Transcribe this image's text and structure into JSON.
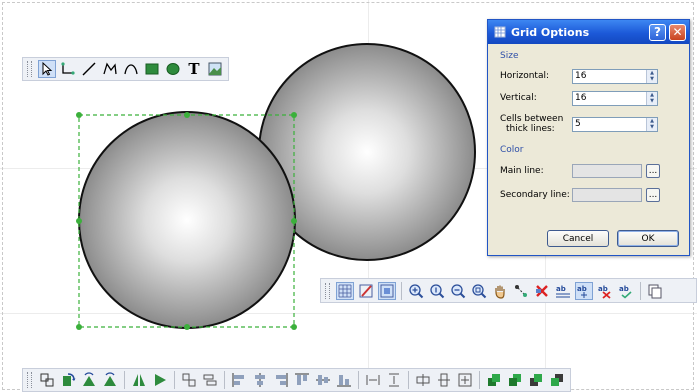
{
  "dialog": {
    "title": "Grid Options",
    "help_label": "?",
    "close_label": "✕",
    "size_section": "Size",
    "horizontal_label": "Horizontal:",
    "horizontal_value": "16",
    "vertical_label": "Vertical:",
    "vertical_value": "16",
    "cells_label_line1": "Cells between",
    "cells_label_line2": "thick lines:",
    "cells_value": "5",
    "color_section": "Color",
    "main_line_label": "Main line:",
    "secondary_line_label": "Secondary line:",
    "ellipsis_label": "...",
    "cancel_label": "Cancel",
    "ok_label": "OK"
  },
  "colors": {
    "selection": "#3bb03b",
    "sphere_outline": "#111111",
    "title_bar": "#1c59d8",
    "section_text": "#2e4fa8"
  },
  "draw_toolbar": {
    "tools": [
      "select-icon",
      "connector-icon",
      "line-icon",
      "polyline-icon",
      "curve-icon",
      "rectangle-icon",
      "ellipse-icon",
      "text-icon",
      "image-icon"
    ],
    "text_tool_glyph": "T"
  },
  "view_toolbar": {
    "tools": [
      "grid-icon",
      "edit-grid-icon",
      "snap-grid-icon",
      "zoom-in-icon",
      "zoom-actual-icon",
      "zoom-out-icon",
      "zoom-fit-icon",
      "pan-hand-icon",
      "connect-icon",
      "delete-connection-icon",
      "align-text-icon",
      "align-text-active-icon",
      "align-text-remove-icon",
      "spell-check-icon",
      "copy-icon"
    ]
  },
  "arrange_toolbar": {
    "tools": [
      "group-icon",
      "rotate-right-icon",
      "rotate-left-icon",
      "flip-horizontal-icon",
      "flip-vertical-icon",
      "same-size-icon",
      "same-width-icon",
      "align-left-icon",
      "align-center-icon",
      "align-right-icon",
      "align-top-icon",
      "align-middle-icon",
      "align-bottom-icon",
      "space-horizontal-icon",
      "space-vertical-icon",
      "center-horizontal-icon",
      "center-vertical-icon",
      "center-both-icon",
      "bring-front-icon",
      "send-back-icon",
      "bring-forward-icon",
      "send-backward-icon"
    ]
  }
}
